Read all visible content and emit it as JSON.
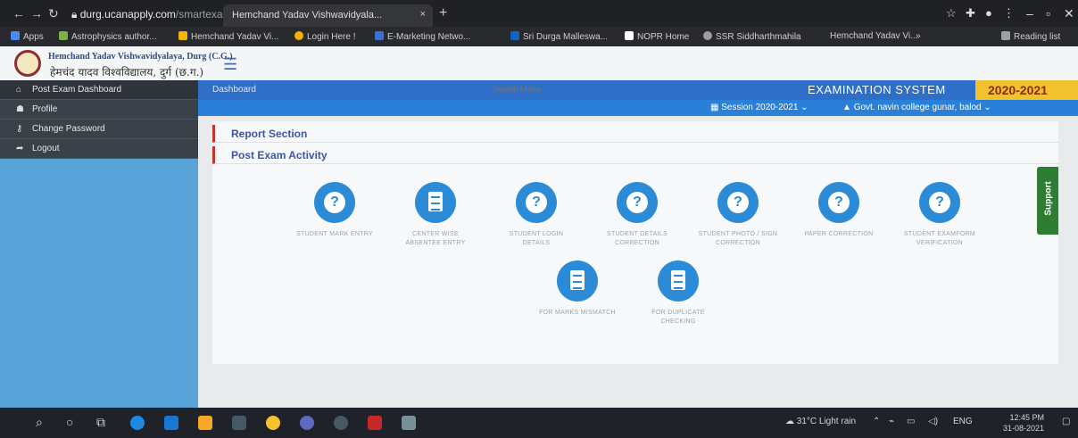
{
  "browser": {
    "tab_title": "Hemchand Yadav Vishwavidyala...",
    "address_host": "durg.ucanapply.com",
    "address_path": "/smartexam/public/college/dashboard",
    "bookmarks": [
      {
        "label": "Apps",
        "color": "#4a8af4"
      },
      {
        "label": "Astrophysics author...",
        "color": "#7cb342"
      },
      {
        "label": "Hemchand Yadav Vi...",
        "color": "#f4b400"
      },
      {
        "label": "Login Here !",
        "color": "#f4b400"
      },
      {
        "label": "E-Marketing Netwo...",
        "color": "#3f6fd8"
      },
      {
        "label": "Sri Durga Malleswa...",
        "color": "#1565c0"
      },
      {
        "label": "NOPR Home",
        "color": "#ffffff"
      },
      {
        "label": "SSR Siddharthmahila",
        "color": "#9e9e9e"
      },
      {
        "label": "Hemchand Yadav Vi...",
        "color": "#f4b400"
      }
    ],
    "reading_list": "Reading list"
  },
  "header": {
    "university_line1": "Hemchand Yadav Vishwavidyalaya, Durg (C.G.)",
    "university_line2": "हेमचंद यादव विश्वविद्यालय, दुर्ग (छ.ग.)"
  },
  "sidebar": {
    "items": [
      {
        "icon": "home-icon",
        "glyph": "⌂",
        "label": "Post Exam Dashboard"
      },
      {
        "icon": "profile-icon",
        "glyph": "☗",
        "label": "Profile"
      },
      {
        "icon": "key-icon",
        "glyph": "⚷",
        "label": "Change Password"
      },
      {
        "icon": "logout-icon",
        "glyph": "➦",
        "label": "Logout"
      }
    ]
  },
  "topbar": {
    "breadcrumb": "Dashboard",
    "search_placeholder": "Search Menu",
    "system_title": "EXAMINATION SYSTEM",
    "year": "2020-2021",
    "session": "Session 2020-2021 ⌄",
    "college": "Govt. navin college gunar, balod ⌄"
  },
  "sections": {
    "report": "Report Section",
    "post_exam": "Post Exam Activity"
  },
  "tiles": [
    {
      "label": "STUDENT MARK ENTRY",
      "icon": "question-icon"
    },
    {
      "label": "CENTER WISE ABSENTEE ENTRY",
      "icon": "clipboard-icon"
    },
    {
      "label": "STUDENT LOGIN DETAILS",
      "icon": "question-icon"
    },
    {
      "label": "STUDENT DETAILS CORRECTION",
      "icon": "question-icon"
    },
    {
      "label": "STUDENT PHOTO / SIGN CORRECTION",
      "icon": "question-icon"
    },
    {
      "label": "PAPER CORRECTION",
      "icon": "question-icon"
    },
    {
      "label": "STUDENT EXAMFORM VERIFICATION",
      "icon": "question-icon"
    },
    {
      "label": "FOR MARKS MISMATCH",
      "icon": "clipboard-icon"
    },
    {
      "label": "FOR DUPLICATE CHECKING",
      "icon": "clipboard-icon"
    }
  ],
  "support_label": "Support",
  "taskbar": {
    "weather": "31°C Light rain",
    "lang": "ENG",
    "time": "12:45 PM",
    "date": "31-08-2021"
  }
}
